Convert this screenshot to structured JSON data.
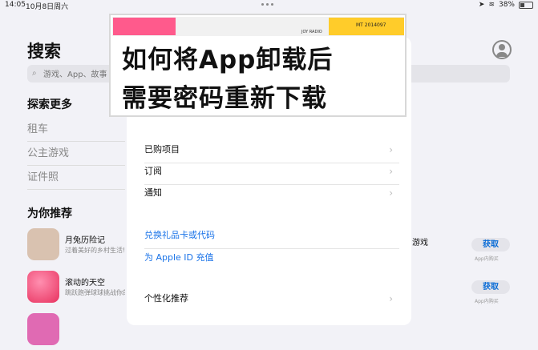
{
  "status_bar": {
    "time": "14:05",
    "date": "10月8日周六",
    "battery": "38%"
  },
  "page": {
    "title": "搜索"
  },
  "search": {
    "placeholder": "游戏、App、故事"
  },
  "explore": {
    "title": "探索更多",
    "items": [
      "租车",
      "公主游戏",
      "证件照"
    ]
  },
  "recommend": {
    "title": "为你推荐",
    "apps": [
      {
        "name": "月兔历险记",
        "desc": "过着美好的乡村生活!",
        "icon_color": "#d9c2b0"
      },
      {
        "name": "滚动的天空",
        "desc": "跳跃跑弹球球挑战你的操作",
        "icon_color": "#ff5f8a"
      },
      {
        "name": "",
        "desc": "",
        "icon_color": "#e06ab3"
      }
    ]
  },
  "right_column": {
    "partial_text": "游戏",
    "get_label": "获取",
    "get_sub": "App内购买"
  },
  "modal": {
    "rows": [
      "已购项目",
      "订阅",
      "通知"
    ],
    "links": [
      "兑换礼品卡或代码",
      "为 Apple ID 充值"
    ],
    "personalize": "个性化推荐"
  },
  "banner": {
    "line1": "如何将App卸载后",
    "line2": "需要密码重新下载",
    "tag_left": "",
    "tag_right": "MT 2014097",
    "joy_radio": "JOY RADIO"
  }
}
